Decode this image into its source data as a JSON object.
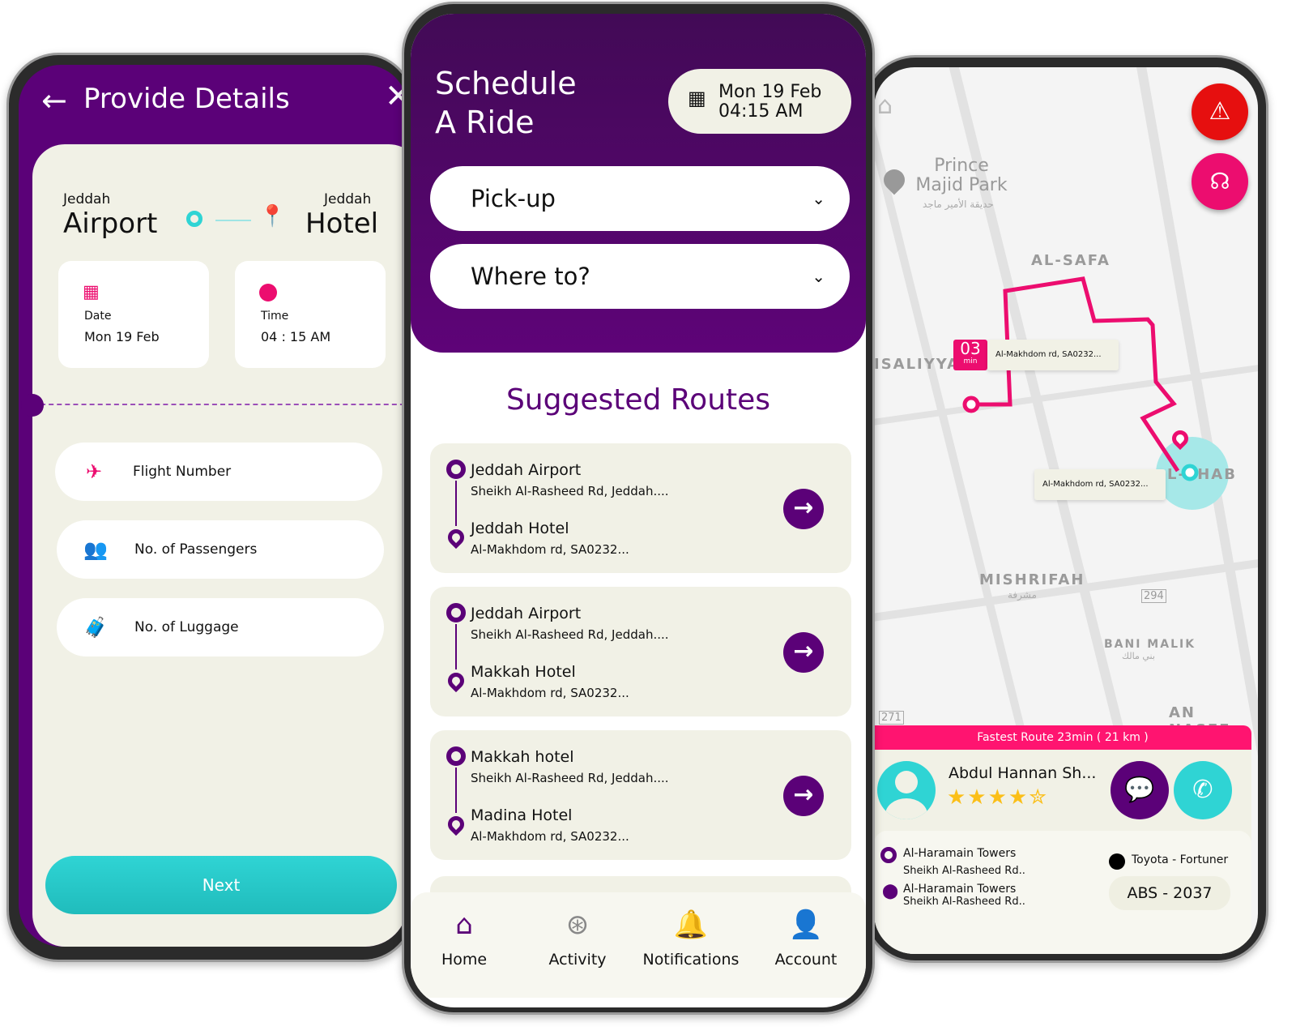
{
  "colors": {
    "purple": "#5b0178",
    "teal": "#2fd4d4",
    "pink": "#ec0d6f",
    "cream": "#f1f1e6",
    "red": "#e60f0f",
    "star": "#fbbf18"
  },
  "details": {
    "title": "Provide Details",
    "back_icon": "arrow-left",
    "close_icon": "close",
    "from_city": "Jeddah",
    "from_place": "Airport",
    "to_city": "Jeddah",
    "to_place": "Hotel",
    "date_label": "Date",
    "date_value": "Mon 19 Feb",
    "time_label": "Time",
    "time_value": "04 : 15 AM",
    "fields": [
      {
        "label": "Flight Number",
        "icon": "airplane"
      },
      {
        "label": "No. of Passengers",
        "icon": "users"
      },
      {
        "label": "No. of Luggage",
        "icon": "luggage"
      }
    ],
    "next": "Next"
  },
  "schedule": {
    "title_line1": "Schedule",
    "title_line2": "A Ride",
    "date_line1": "Mon 19 Feb",
    "date_line2": "04:15 AM",
    "pickup": "Pick-up",
    "whereto": "Where to?",
    "suggested_title": "Suggested Routes",
    "routes": [
      {
        "from": "Jeddah Airport",
        "from_addr": "Sheikh Al-Rasheed Rd, Jeddah....",
        "to": "Jeddah Hotel",
        "to_addr": "Al-Makhdom rd, SA0232..."
      },
      {
        "from": "Jeddah Airport",
        "from_addr": "Sheikh Al-Rasheed Rd, Jeddah....",
        "to": "Makkah Hotel",
        "to_addr": "Al-Makhdom rd, SA0232..."
      },
      {
        "from": "Makkah hotel",
        "from_addr": "Sheikh Al-Rasheed Rd, Jeddah....",
        "to": "Madina Hotel",
        "to_addr": "Al-Makhdom rd, SA0232..."
      }
    ],
    "tabs": [
      {
        "label": "Home",
        "icon": "home",
        "active": true
      },
      {
        "label": "Activity",
        "icon": "wheel"
      },
      {
        "label": "Notifications",
        "icon": "bell"
      },
      {
        "label": "Account",
        "icon": "user"
      }
    ]
  },
  "map": {
    "labels": {
      "park": "Prince Majid Park",
      "park_ar": "حديقة الأمير ماجد",
      "safa": "AL-SAFA",
      "isaliyya": "ISALIYYA",
      "mishrifah": "MISHRIFAH",
      "mishrifah_ar": "مشرفة",
      "bani_malik": "BANI MALIK",
      "bani_malik_ar": "بني مالك",
      "an_nasee": "AN NASEE",
      "ehab": "L-EHAB",
      "road294": "294",
      "road271": "271"
    },
    "eta_value": "03",
    "eta_unit": "min",
    "callout1": "Al-Makhdom rd, SA0232...",
    "callout2": "Al-Makhdom rd, SA0232...",
    "fastest": "Fastest Route 23min ( 21 km )",
    "driver_name": "Abdul Hannan Sh...",
    "rating": 4.5,
    "pickup_name": "Al-Haramain Towers",
    "pickup_addr": "Sheikh Al-Rasheed Rd..",
    "drop_name": "Al-Haramain Towers",
    "drop_addr": "Sheikh Al-Rasheed Rd..",
    "car": "Toyota - Fortuner",
    "plate": "ABS - 2037"
  }
}
